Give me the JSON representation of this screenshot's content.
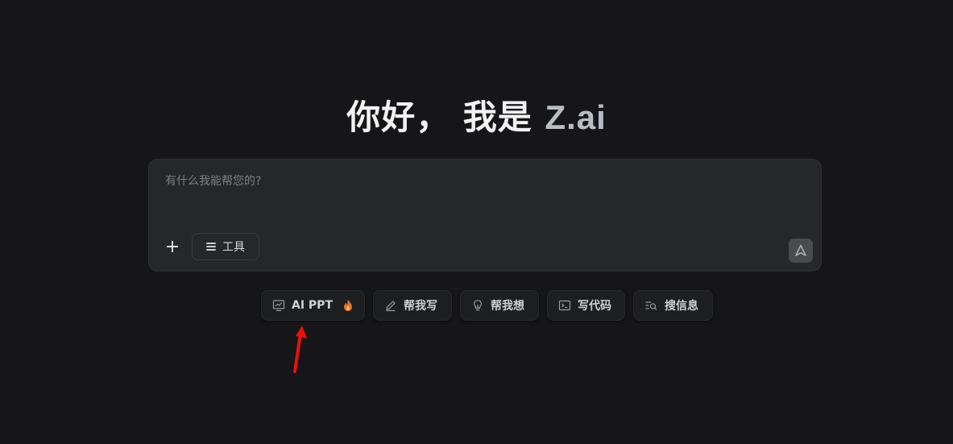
{
  "greeting": {
    "hello": "你好， 我是 ",
    "brand": "Z.ai"
  },
  "composer": {
    "placeholder": "有什么我能帮您的?",
    "plus_label": "+",
    "tools_label": "工具"
  },
  "chips": [
    {
      "label": "AI PPT",
      "icon": "presentation-chart-icon",
      "badge": "fire-icon"
    },
    {
      "label": "帮我写",
      "icon": "pencil-icon"
    },
    {
      "label": "帮我想",
      "icon": "lightbulb-icon"
    },
    {
      "label": "写代码",
      "icon": "terminal-icon"
    },
    {
      "label": "搜信息",
      "icon": "search-list-icon"
    }
  ],
  "colors": {
    "background": "#161618",
    "composer_bg": "#262729",
    "annotation_arrow": "#e8120c"
  }
}
